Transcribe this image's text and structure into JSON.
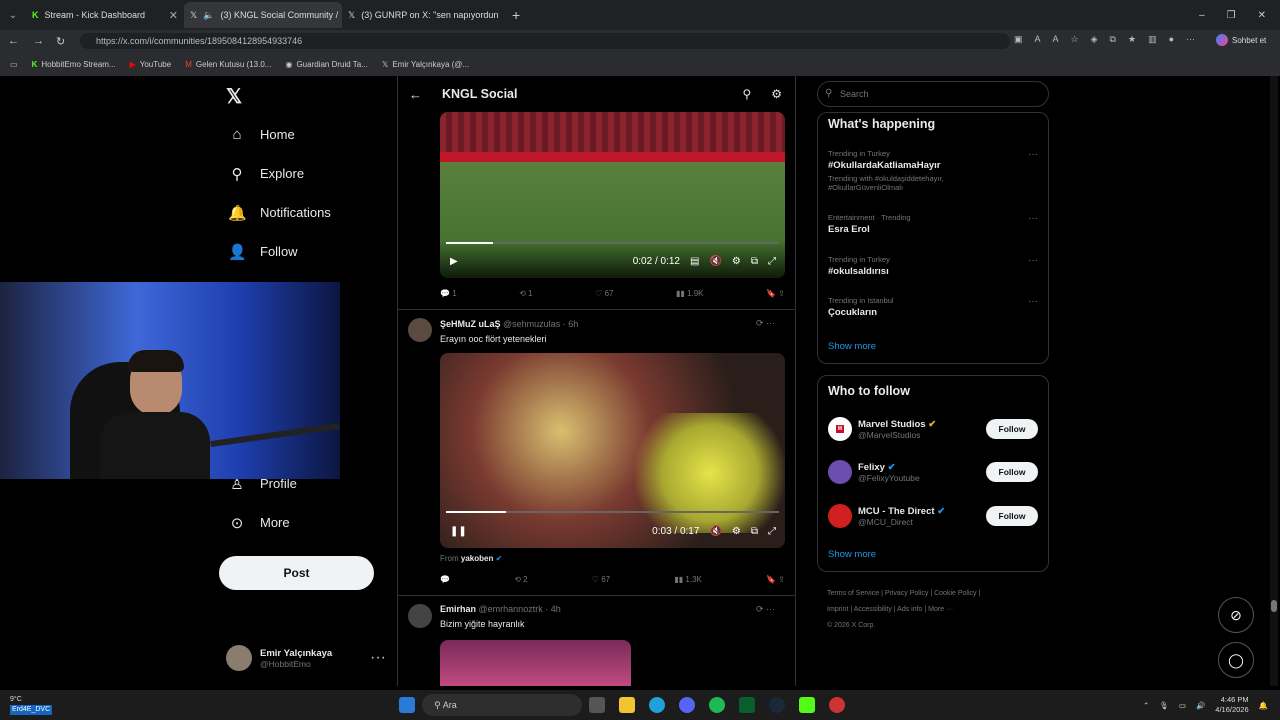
{
  "tabs": [
    {
      "title": "Stream - Kick Dashboard",
      "icon": "kick-icon"
    },
    {
      "title": "(3) KNGL Social Community /",
      "icon": "x-icon"
    },
    {
      "title": "(3) GUNRP on X: \"sen napıyordun",
      "icon": "x-icon"
    }
  ],
  "url": "https://x.com/i/communities/1895084128954933746",
  "bookmarks": [
    "HobbitEmo Stream...",
    "YouTube",
    "Gelen Kutusu (13.0...",
    "Guardian Druid Ta...",
    "Emir Yalçınkaya (@..."
  ],
  "browser_chat": "Sohbet et",
  "nav": {
    "home": "Home",
    "explore": "Explore",
    "notifications": "Notifications",
    "follow": "Follow",
    "profile": "Profile",
    "more": "More",
    "post": "Post"
  },
  "account": {
    "name": "Emir Yalçınkaya",
    "handle": "@HobbitEmo"
  },
  "community": {
    "title": "KNGL Social"
  },
  "tweets": [
    {
      "video_time": "0:02 / 0:12",
      "replies": "1",
      "reposts": "1",
      "likes": "67",
      "views": "1.9K"
    },
    {
      "name": "ŞeHMuZ uLaŞ",
      "handle": "@sehmuzulas · 6h",
      "text": "Erayın ooc flört yetenekleri",
      "video_time": "0:03 / 0:17",
      "from_label": "From",
      "from_name": "yakoben",
      "replies": "",
      "reposts": "2",
      "likes": "67",
      "views": "1.3K"
    },
    {
      "name": "Emirhan",
      "handle": "@emrhannoztrk · 4h",
      "text": "Bizim yiğite hayranlık"
    }
  ],
  "search_placeholder": "Search",
  "whats_happening": {
    "title": "What's happening",
    "trends": [
      {
        "meta": "Trending in Turkey",
        "name": "#OkullardaKatliamaHayır",
        "extra": "Trending with #okuldaşiddetehayır, #OkullarGüvenliOlmalı"
      },
      {
        "meta": "Entertainment · Trending",
        "name": "Esra Erol",
        "extra": ""
      },
      {
        "meta": "Trending in Turkey",
        "name": "#okulsaldırısı",
        "extra": ""
      },
      {
        "meta": "Trending in Istanbul",
        "name": "Çocukların",
        "extra": ""
      }
    ],
    "show_more": "Show more"
  },
  "who_to_follow": {
    "title": "Who to follow",
    "accounts": [
      {
        "name": "Marvel Studios",
        "handle": "@MarvelStudios",
        "button": "Follow",
        "color": "#c8102e"
      },
      {
        "name": "Felixy",
        "handle": "@FelixyYoutube",
        "button": "Follow",
        "color": "#6b4fb0"
      },
      {
        "name": "MCU - The Direct",
        "handle": "@MCU_Direct",
        "button": "Follow",
        "color": "#d11f1f"
      }
    ],
    "show_more": "Show more"
  },
  "footer": {
    "line1": "Terms of Service  |  Privacy Policy  |  Cookie Policy  |",
    "line2": "Imprint  |  Accessibility  |  Ads info  |  More ···",
    "line3": "© 2026 X Corp."
  },
  "taskbar": {
    "weather": "9°C",
    "user_tag": "Erd4E_DVC",
    "search": "Ara",
    "time": "4:46 PM",
    "date": "4/16/2026"
  },
  "colors": {
    "accent": "#1d9bf0",
    "background": "#000000"
  }
}
